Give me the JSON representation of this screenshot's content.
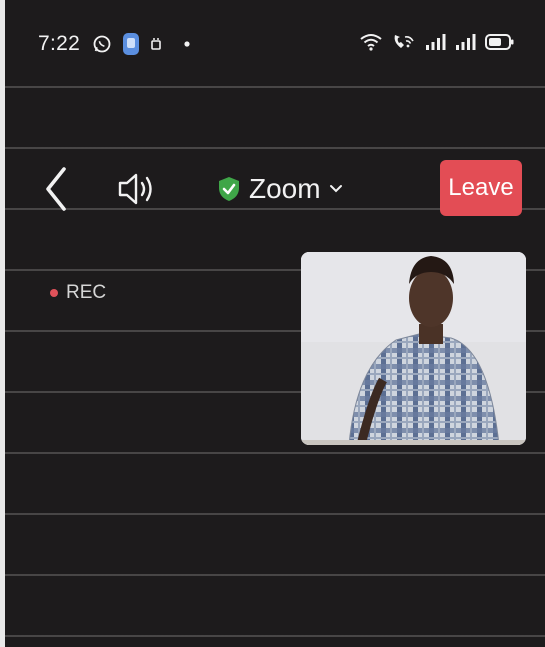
{
  "status_bar": {
    "time": "7:22",
    "left_icons": [
      "whatsapp-icon",
      "messages-app-icon",
      "notification-icon",
      "dot-icon"
    ],
    "right_icons": [
      "wifi-icon",
      "wifi-calling-icon",
      "signal-icon",
      "signal-icon",
      "battery-icon"
    ]
  },
  "toolbar": {
    "back_icon": "chevron-left-icon",
    "speaker_icon": "speaker-icon",
    "shield_icon": "shield-check-icon",
    "title": "Zoom",
    "title_dropdown_icon": "chevron-down-icon",
    "leave_label": "Leave",
    "shield_color": "#3fa648",
    "leave_color": "#e34d55"
  },
  "recording": {
    "label": "REC",
    "dot_color": "#e0525a"
  },
  "video": {
    "participant_icon": "participant-video"
  },
  "colors": {
    "background": "#1d1b1c",
    "text": "#f2f2f2"
  }
}
